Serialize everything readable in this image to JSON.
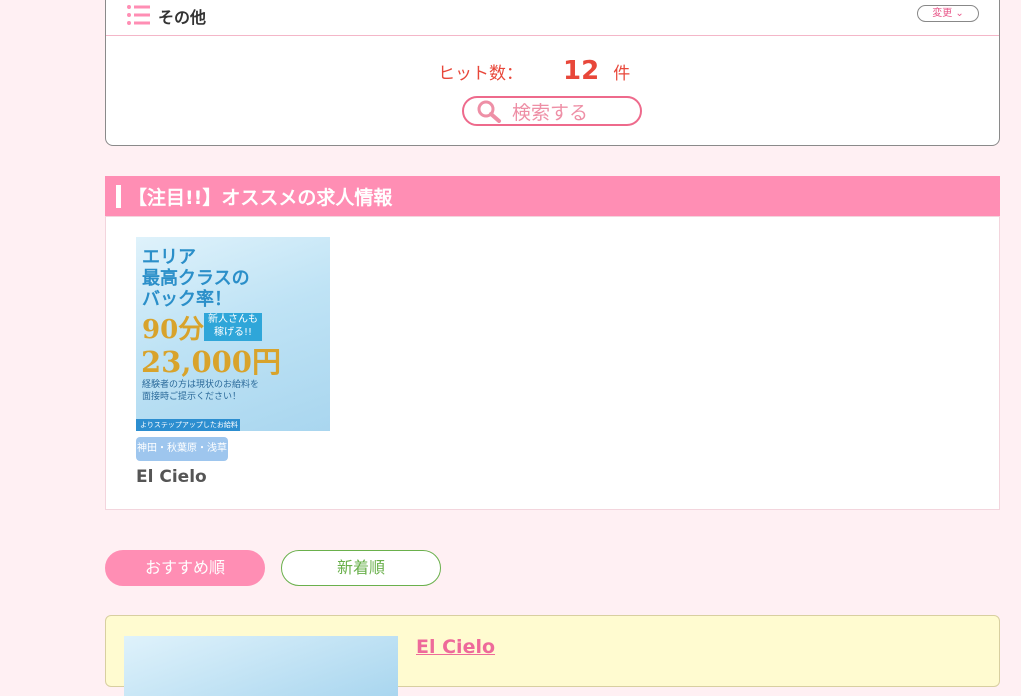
{
  "search": {
    "category_label": "その他",
    "change_label": "変更",
    "hit_label": "ヒット数：",
    "hit_count": "12",
    "hit_unit": "件",
    "search_button": "検索する"
  },
  "featured": {
    "title": "【注目!!】オススメの求人情報",
    "card": {
      "ad_line1": "エリア",
      "ad_line2": "最高クラスの",
      "ad_line3": "バック率！",
      "ad_90": "90分",
      "ad_badge": "新人さんも稼げる!!",
      "ad_price": "23,000円",
      "ad_small1": "経験者の方は現状のお給料を",
      "ad_small2": "面接時ご提示ください！",
      "ad_foot": "よりステップアップしたお給料へ!",
      "area": "神田・秋葉原・浅草",
      "name": "El Cielo"
    }
  },
  "sort": {
    "recommended": "おすすめ順",
    "newest": "新着順"
  },
  "listing": {
    "name": "El Cielo"
  },
  "colors": {
    "pink": "#ff8eb4",
    "green": "#6ab04c",
    "red": "#e8473a"
  }
}
